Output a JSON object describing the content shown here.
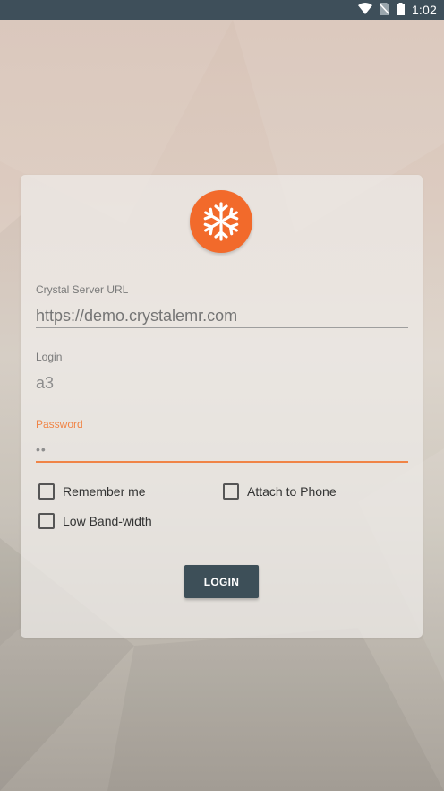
{
  "status_bar": {
    "time": "1:02",
    "icons": [
      "wifi-icon",
      "no-sim-icon",
      "battery-icon"
    ]
  },
  "login_form": {
    "logo": "snowflake-logo",
    "server_url": {
      "label": "Crystal Server URL",
      "placeholder": "https://demo.crystalemr.com"
    },
    "login": {
      "label": "Login",
      "value": "a3"
    },
    "password": {
      "label": "Password",
      "value": "••"
    },
    "options": {
      "remember_me": {
        "label": "Remember me",
        "checked": false
      },
      "attach_to_phone": {
        "label": "Attach to Phone",
        "checked": false
      },
      "low_bandwidth": {
        "label": "Low Band-width",
        "checked": false
      }
    },
    "login_button": "LOGIN"
  },
  "colors": {
    "accent": "#f08446",
    "logo": "#f26a2b",
    "button": "#3d4f58",
    "status_bar": "#3e4f5a"
  }
}
